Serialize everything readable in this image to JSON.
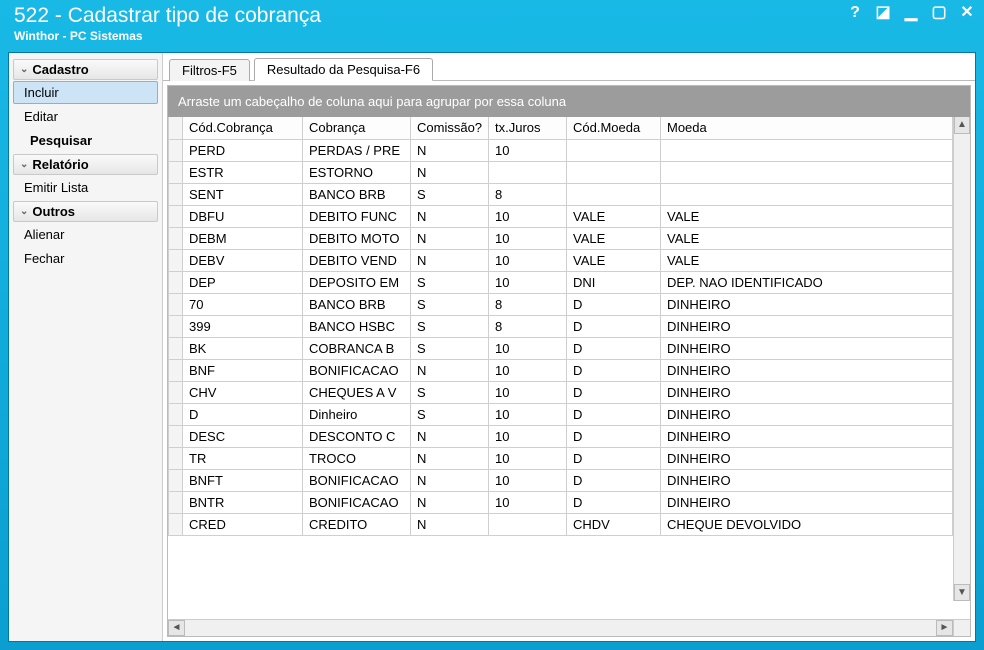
{
  "window": {
    "title": "522 - Cadastrar tipo de cobrança",
    "subtitle": "Winthor - PC Sistemas"
  },
  "sidebar": {
    "groups": [
      {
        "label": "Cadastro",
        "items": [
          {
            "label": "Incluir",
            "selected": true
          },
          {
            "label": "Editar",
            "selected": false
          },
          {
            "label": "Pesquisar",
            "sub": true
          }
        ]
      },
      {
        "label": "Relatório",
        "items": [
          {
            "label": "Emitir Lista"
          }
        ]
      },
      {
        "label": "Outros",
        "items": [
          {
            "label": "Alienar"
          },
          {
            "label": "Fechar"
          }
        ]
      }
    ]
  },
  "tabs": [
    {
      "label": "Filtros-F5",
      "active": false
    },
    {
      "label": "Resultado da Pesquisa-F6",
      "active": true
    }
  ],
  "grid": {
    "group_hint": "Arraste um cabeçalho de coluna aqui para agrupar por essa coluna",
    "columns": [
      "Cód.Cobrança",
      "Cobrança",
      "Comissão?",
      "tx.Juros",
      "Cód.Moeda",
      "Moeda"
    ],
    "rows": [
      {
        "cod": "PERD",
        "cob": "PERDAS / PRE",
        "com": "N",
        "jur": "10",
        "cmo": "",
        "moe": ""
      },
      {
        "cod": "ESTR",
        "cob": "ESTORNO",
        "com": "N",
        "jur": "",
        "cmo": "",
        "moe": ""
      },
      {
        "cod": "SENT",
        "cob": "BANCO BRB",
        "com": "S",
        "jur": "8",
        "cmo": "",
        "moe": ""
      },
      {
        "cod": "DBFU",
        "cob": "DEBITO FUNC",
        "com": "N",
        "jur": "10",
        "cmo": "VALE",
        "moe": "VALE"
      },
      {
        "cod": "DEBM",
        "cob": "DEBITO MOTO",
        "com": "N",
        "jur": "10",
        "cmo": "VALE",
        "moe": "VALE"
      },
      {
        "cod": "DEBV",
        "cob": "DEBITO VEND",
        "com": "N",
        "jur": "10",
        "cmo": "VALE",
        "moe": "VALE"
      },
      {
        "cod": "DEP",
        "cob": "DEPOSITO EM",
        "com": "S",
        "jur": "10",
        "cmo": "DNI",
        "moe": "DEP. NAO IDENTIFICADO"
      },
      {
        "cod": "70",
        "cob": "BANCO BRB",
        "com": "S",
        "jur": "8",
        "cmo": "D",
        "moe": "DINHEIRO"
      },
      {
        "cod": "399",
        "cob": "BANCO HSBC",
        "com": "S",
        "jur": "8",
        "cmo": "D",
        "moe": "DINHEIRO"
      },
      {
        "cod": "BK",
        "cob": "COBRANCA B",
        "com": "S",
        "jur": "10",
        "cmo": "D",
        "moe": "DINHEIRO"
      },
      {
        "cod": "BNF",
        "cob": "BONIFICACAO",
        "com": "N",
        "jur": "10",
        "cmo": "D",
        "moe": "DINHEIRO"
      },
      {
        "cod": "CHV",
        "cob": "CHEQUES A V",
        "com": "S",
        "jur": "10",
        "cmo": "D",
        "moe": "DINHEIRO"
      },
      {
        "cod": "D",
        "cob": "Dinheiro",
        "com": "S",
        "jur": "10",
        "cmo": "D",
        "moe": "DINHEIRO"
      },
      {
        "cod": "DESC",
        "cob": "DESCONTO C",
        "com": "N",
        "jur": "10",
        "cmo": "D",
        "moe": "DINHEIRO"
      },
      {
        "cod": "TR",
        "cob": "TROCO",
        "com": "N",
        "jur": "10",
        "cmo": "D",
        "moe": "DINHEIRO"
      },
      {
        "cod": "BNFT",
        "cob": "BONIFICACAO",
        "com": "N",
        "jur": "10",
        "cmo": "D",
        "moe": "DINHEIRO"
      },
      {
        "cod": "BNTR",
        "cob": "BONIFICACAO",
        "com": "N",
        "jur": "10",
        "cmo": "D",
        "moe": "DINHEIRO"
      },
      {
        "cod": "CRED",
        "cob": "CREDITO",
        "com": "N",
        "jur": "",
        "cmo": "CHDV",
        "moe": "CHEQUE DEVOLVIDO"
      }
    ]
  }
}
